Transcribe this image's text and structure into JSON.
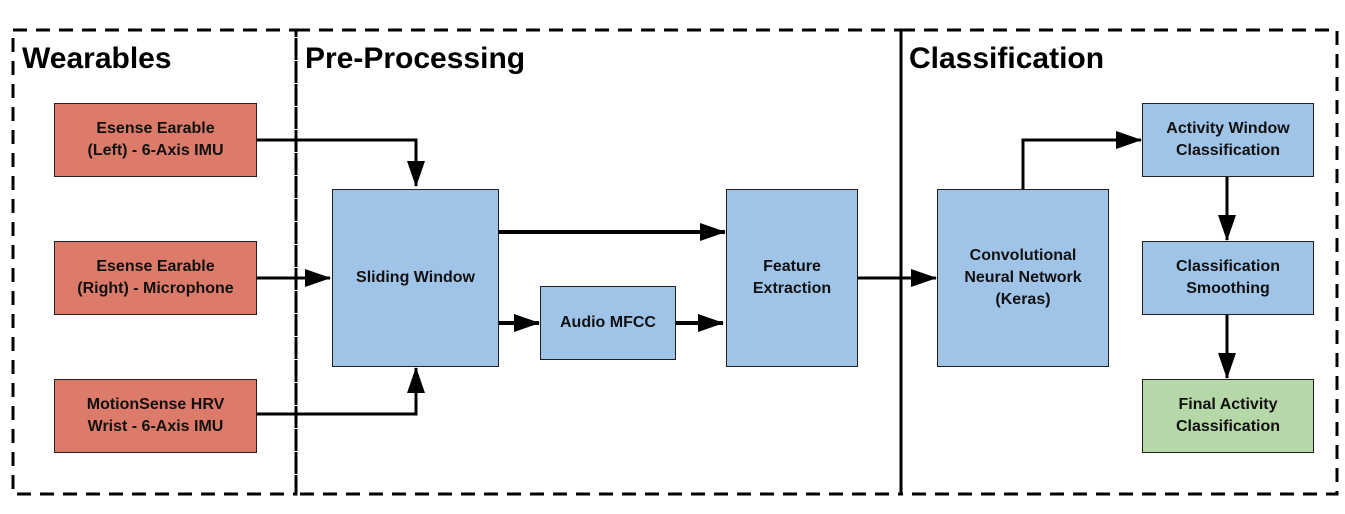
{
  "sections": [
    {
      "id": "wearables",
      "title": "Wearables"
    },
    {
      "id": "preprocessing",
      "title": "Pre-Processing"
    },
    {
      "id": "classification",
      "title": "Classification"
    }
  ],
  "nodes": {
    "esense_left": {
      "label": "Esense Earable\n(Left) - 6-Axis IMU",
      "color": "#dd7b6a"
    },
    "esense_right": {
      "label": "Esense Earable\n(Right) - Microphone",
      "color": "#dd7b6a"
    },
    "motionsense": {
      "label": "MotionSense HRV\nWrist - 6-Axis IMU",
      "color": "#dd7b6a"
    },
    "sliding_window": {
      "label": "Sliding Window",
      "color": "#9fc4e8"
    },
    "audio_mfcc": {
      "label": "Audio MFCC",
      "color": "#9fc4e8"
    },
    "feature_extraction": {
      "label": "Feature\nExtraction",
      "color": "#9fc4e8"
    },
    "cnn": {
      "label": "Convolutional\nNeural Network\n(Keras)",
      "color": "#9fc4e8"
    },
    "activity_window": {
      "label": "Activity Window\nClassification",
      "color": "#9fc4e8"
    },
    "smoothing": {
      "label": "Classification\nSmoothing",
      "color": "#9fc4e8"
    },
    "final": {
      "label": "Final Activity\nClassification",
      "color": "#b6d7a8"
    }
  },
  "edges": [
    {
      "from": "esense_left",
      "to": "sliding_window"
    },
    {
      "from": "esense_right",
      "to": "sliding_window"
    },
    {
      "from": "motionsense",
      "to": "sliding_window"
    },
    {
      "from": "sliding_window",
      "to": "feature_extraction"
    },
    {
      "from": "sliding_window",
      "to": "audio_mfcc"
    },
    {
      "from": "audio_mfcc",
      "to": "feature_extraction"
    },
    {
      "from": "feature_extraction",
      "to": "cnn"
    },
    {
      "from": "cnn",
      "to": "activity_window"
    },
    {
      "from": "activity_window",
      "to": "smoothing"
    },
    {
      "from": "smoothing",
      "to": "final"
    }
  ]
}
